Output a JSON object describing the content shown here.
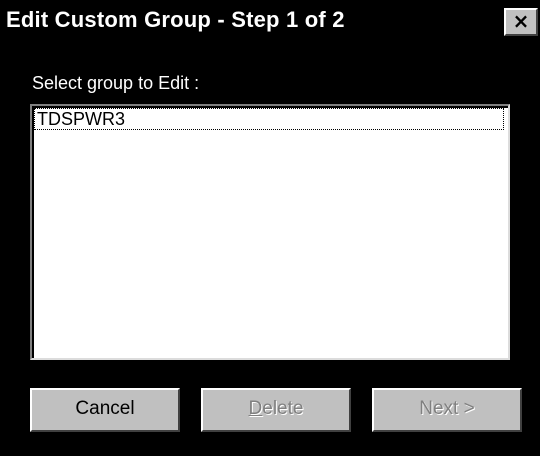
{
  "dialog": {
    "title": "Edit Custom Group - Step 1 of 2",
    "close_label": "×"
  },
  "group_select": {
    "label": "Select group to Edit :",
    "items": [
      "TDSPWR3"
    ],
    "selected_index": 0
  },
  "buttons": {
    "cancel_label": "Cancel",
    "delete_label": "Delete",
    "delete_enabled": false,
    "next_label": "Next >",
    "next_enabled": false
  },
  "colors": {
    "background": "#000000",
    "button_face": "#c0c0c0",
    "listbox_background": "#ffffff",
    "disabled_text": "#808080"
  }
}
